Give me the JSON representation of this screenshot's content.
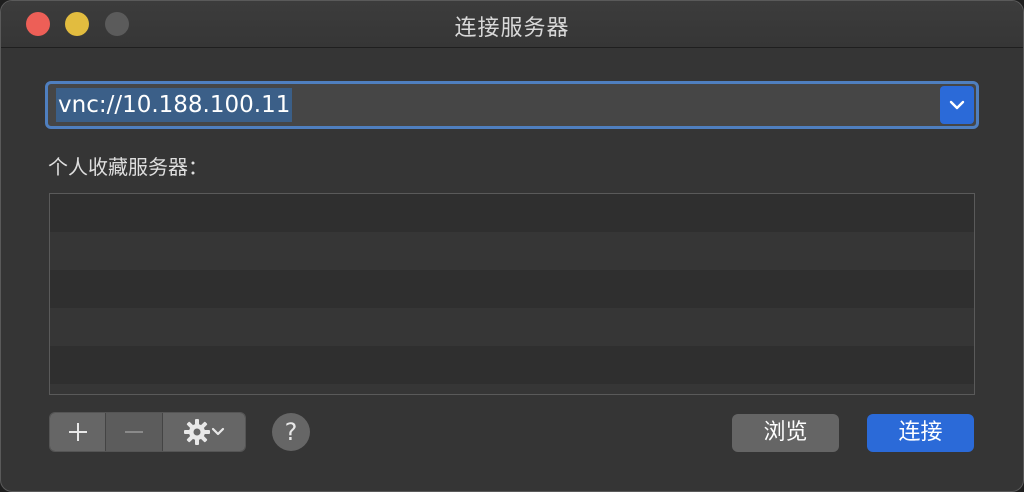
{
  "window": {
    "title": "连接服务器"
  },
  "address_bar": {
    "value": "vnc://10.188.100.11"
  },
  "favorites": {
    "label": "个人收藏服务器：",
    "items": []
  },
  "toolbar": {
    "add_icon": "plus-icon",
    "remove_icon": "minus-icon",
    "gear_icon": "gear-icon",
    "help_label": "?"
  },
  "actions": {
    "browse_label": "浏览",
    "connect_label": "连接"
  },
  "colors": {
    "accent": "#2b6ad8",
    "close": "#ed5f57",
    "minimize": "#e2bc3f",
    "zoom_inactive": "#5b5b5b"
  }
}
